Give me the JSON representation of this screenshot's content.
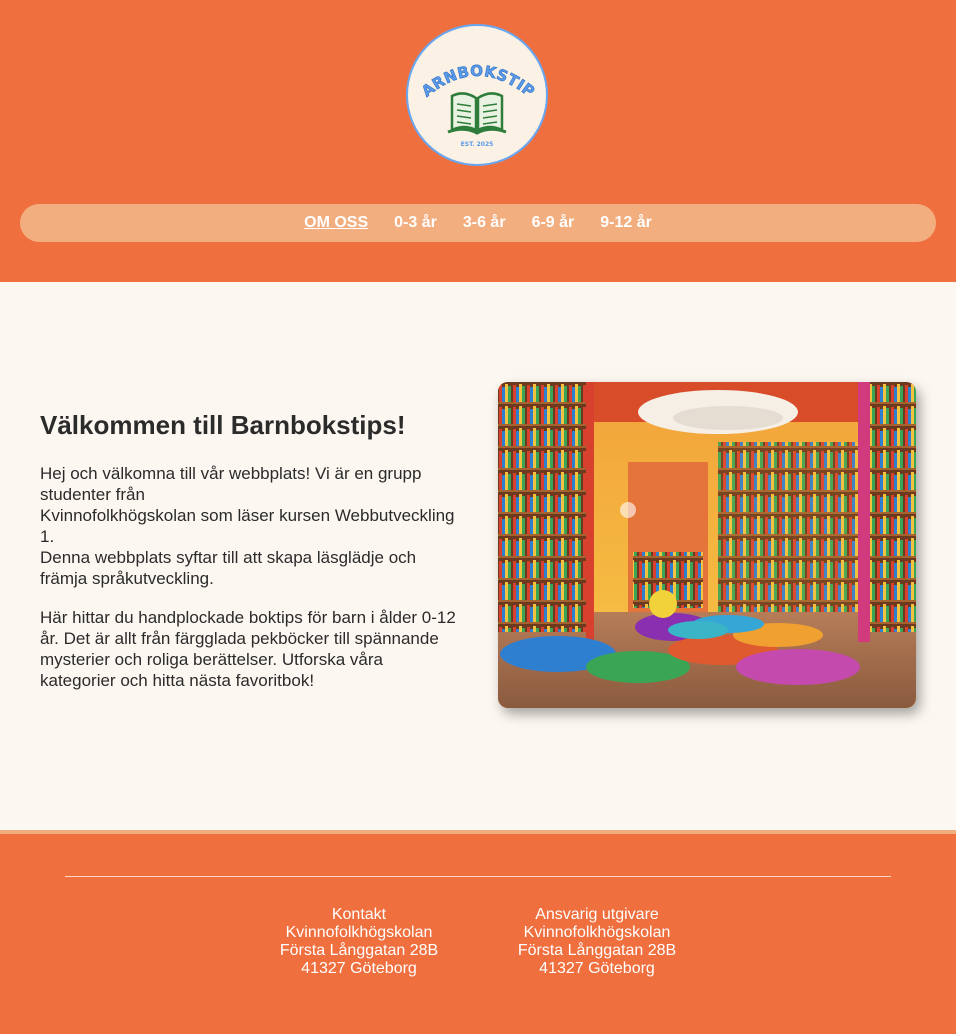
{
  "logo": {
    "title": "BARNBOKSTIPS",
    "est": "EST. 2025",
    "icon": "open-book-icon"
  },
  "nav": {
    "items": [
      {
        "label": "OM OSS",
        "active": true
      },
      {
        "label": "0-3 år",
        "active": false
      },
      {
        "label": "3-6 år",
        "active": false
      },
      {
        "label": "6-9 år",
        "active": false
      },
      {
        "label": "9-12 år",
        "active": false
      }
    ]
  },
  "intro": {
    "heading": "Välkommen till Barnbokstips!",
    "p1_line1": "Hej och välkomna till vår webbplats! Vi är en grupp studenter från",
    "p1_line2": "Kvinnofolkhögskolan som läser kursen Webbutveckling 1.",
    "p1_line3": "Denna webbplats syftar till att skapa läsglädje och främja språkutveckling.",
    "p2": "Här hittar du handplockade boktips för barn i ålder 0-12 år. Det är allt från färgglada pekböcker till spännande mysterier och roliga berättelser. Utforska våra kategorier och hitta nästa favoritbok!"
  },
  "footer": {
    "contact": {
      "title": "Kontakt",
      "org": "Kvinnofolkhögskolan",
      "street": "Första Långgatan 28B",
      "city": "41327 Göteborg"
    },
    "publisher": {
      "title": "Ansvarig utgivare",
      "org": "Kvinnofolkhögskolan",
      "street": "Första Långgatan 28B",
      "city": "41327 Göteborg"
    }
  },
  "colors": {
    "brand_orange": "#ef6f3e",
    "nav_bar": "#f3ae7f",
    "background": "#fcf7f1",
    "logo_blue": "#5b9bea",
    "logo_green": "#2e7d3a"
  }
}
